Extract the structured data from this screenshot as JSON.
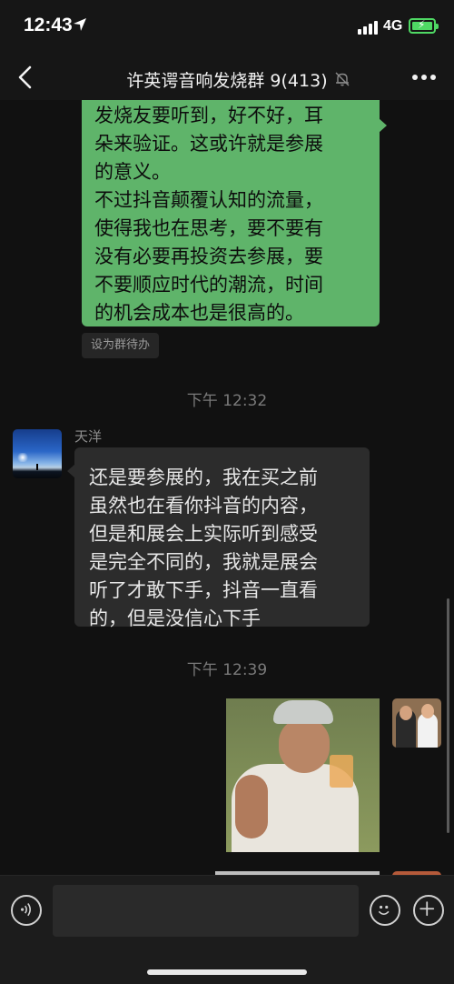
{
  "status_bar": {
    "time": "12:43",
    "network": "4G"
  },
  "nav": {
    "title": "许英谔音响发烧群 9(413)"
  },
  "messages": {
    "green_lines": [
      "发烧友要听到，好不好，耳",
      "朵来验证。这或许就是参展",
      "的意义。",
      "不过抖音颠覆认知的流量，",
      "使得我也在思考，要不要有",
      "没有必要再投资去参展，要",
      "不要顺应时代的潮流，时间",
      "的机会成本也是很高的。"
    ],
    "todo_tag": "设为群待办",
    "timestamp_1": "下午 12:32",
    "sender_name": "天洋",
    "dark_lines": [
      "还是要参展的，我在买之前",
      "虽然也在看你抖音的内容，",
      "但是和展会上实际听到感受",
      "是完全不同的，我就是展会",
      "听了才敢下手，抖音一直看",
      "的，但是没信心下手"
    ],
    "timestamp_2": "下午 12:39"
  },
  "input_bar": {
    "placeholder": ""
  },
  "colors": {
    "sent_bubble": "#5fb46a",
    "received_bubble": "#2c2c2c",
    "background": "#111111"
  },
  "icons": [
    "location-arrow-icon",
    "signal-icon",
    "battery-charging-icon",
    "back-chevron-icon",
    "mute-bell-icon",
    "more-dots-icon",
    "voice-icon",
    "emoji-icon",
    "plus-icon"
  ]
}
